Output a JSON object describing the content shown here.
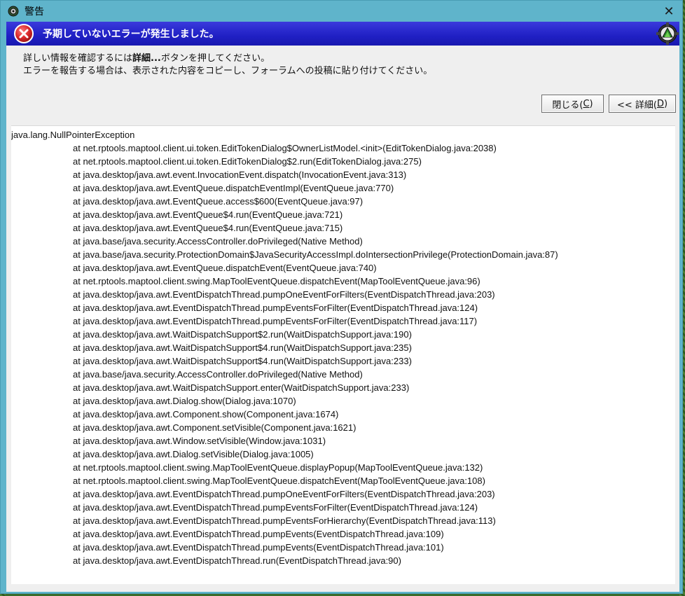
{
  "window": {
    "title": "警告"
  },
  "banner": {
    "text": "予期していないエラーが発生しました。"
  },
  "message": {
    "line1_pre": "詳しい情報を確認するには",
    "line1_bold": "詳細...",
    "line1_post": "ボタンを押してください。",
    "line2": "エラーを報告する場合は、表示された内容をコピーし、フォーラムへの投稿に貼り付けてください。"
  },
  "buttons": {
    "close_label": "閉じる(",
    "close_mnemonic": "C",
    "close_suffix": ")",
    "details_label": "<< 詳細(",
    "details_mnemonic": "D",
    "details_suffix": ")"
  },
  "trace": {
    "exception": "java.lang.NullPointerException",
    "frames": [
      "at net.rptools.maptool.client.ui.token.EditTokenDialog$OwnerListModel.<init>(EditTokenDialog.java:2038)",
      "at net.rptools.maptool.client.ui.token.EditTokenDialog$2.run(EditTokenDialog.java:275)",
      "at java.desktop/java.awt.event.InvocationEvent.dispatch(InvocationEvent.java:313)",
      "at java.desktop/java.awt.EventQueue.dispatchEventImpl(EventQueue.java:770)",
      "at java.desktop/java.awt.EventQueue.access$600(EventQueue.java:97)",
      "at java.desktop/java.awt.EventQueue$4.run(EventQueue.java:721)",
      "at java.desktop/java.awt.EventQueue$4.run(EventQueue.java:715)",
      "at java.base/java.security.AccessController.doPrivileged(Native Method)",
      "at java.base/java.security.ProtectionDomain$JavaSecurityAccessImpl.doIntersectionPrivilege(ProtectionDomain.java:87)",
      "at java.desktop/java.awt.EventQueue.dispatchEvent(EventQueue.java:740)",
      "at net.rptools.maptool.client.swing.MapToolEventQueue.dispatchEvent(MapToolEventQueue.java:96)",
      "at java.desktop/java.awt.EventDispatchThread.pumpOneEventForFilters(EventDispatchThread.java:203)",
      "at java.desktop/java.awt.EventDispatchThread.pumpEventsForFilter(EventDispatchThread.java:124)",
      "at java.desktop/java.awt.EventDispatchThread.pumpEventsForFilter(EventDispatchThread.java:117)",
      "at java.desktop/java.awt.WaitDispatchSupport$2.run(WaitDispatchSupport.java:190)",
      "at java.desktop/java.awt.WaitDispatchSupport$4.run(WaitDispatchSupport.java:235)",
      "at java.desktop/java.awt.WaitDispatchSupport$4.run(WaitDispatchSupport.java:233)",
      "at java.base/java.security.AccessController.doPrivileged(Native Method)",
      "at java.desktop/java.awt.WaitDispatchSupport.enter(WaitDispatchSupport.java:233)",
      "at java.desktop/java.awt.Dialog.show(Dialog.java:1070)",
      "at java.desktop/java.awt.Component.show(Component.java:1674)",
      "at java.desktop/java.awt.Component.setVisible(Component.java:1621)",
      "at java.desktop/java.awt.Window.setVisible(Window.java:1031)",
      "at java.desktop/java.awt.Dialog.setVisible(Dialog.java:1005)",
      "at net.rptools.maptool.client.swing.MapToolEventQueue.displayPopup(MapToolEventQueue.java:132)",
      "at net.rptools.maptool.client.swing.MapToolEventQueue.dispatchEvent(MapToolEventQueue.java:108)",
      "at java.desktop/java.awt.EventDispatchThread.pumpOneEventForFilters(EventDispatchThread.java:203)",
      "at java.desktop/java.awt.EventDispatchThread.pumpEventsForFilter(EventDispatchThread.java:124)",
      "at java.desktop/java.awt.EventDispatchThread.pumpEventsForHierarchy(EventDispatchThread.java:113)",
      "at java.desktop/java.awt.EventDispatchThread.pumpEvents(EventDispatchThread.java:109)",
      "at java.desktop/java.awt.EventDispatchThread.pumpEvents(EventDispatchThread.java:101)",
      "at java.desktop/java.awt.EventDispatchThread.run(EventDispatchThread.java:90)"
    ]
  },
  "icons": {
    "title": "app-icon",
    "close": "close-icon",
    "error": "error-icon",
    "gear": "gear-icon"
  },
  "colors": {
    "titlebar": "#5fb4cb",
    "banner": "#2020c4",
    "error_red": "#d9282a"
  }
}
